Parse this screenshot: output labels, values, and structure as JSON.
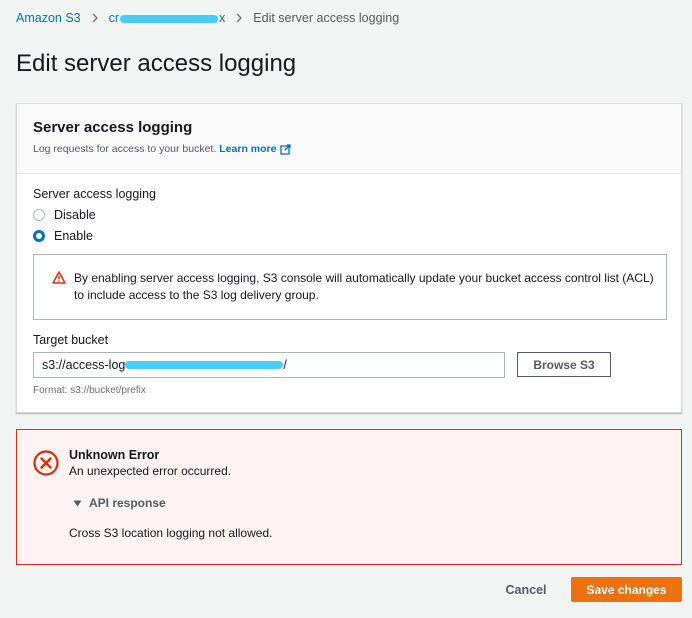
{
  "breadcrumb": {
    "root": "Amazon S3",
    "bucket_prefix": "cr",
    "bucket_suffix": "x",
    "current": "Edit server access logging"
  },
  "page_title": "Edit server access logging",
  "panel": {
    "title": "Server access logging",
    "description": "Log requests for access to your bucket.",
    "learn_more": "Learn more"
  },
  "logging_field": {
    "label": "Server access logging",
    "options": [
      {
        "label": "Disable",
        "selected": false
      },
      {
        "label": "Enable",
        "selected": true
      }
    ]
  },
  "warning": {
    "text": "By enabling server access logging, S3 console will automatically update your bucket access control list (ACL) to include access to the S3 log delivery group."
  },
  "target_bucket": {
    "label": "Target bucket",
    "value_prefix": "s3://access-log",
    "value_suffix": "/",
    "browse_label": "Browse S3",
    "hint": "Format: s3://bucket/prefix"
  },
  "error": {
    "title": "Unknown Error",
    "message": "An unexpected error occurred.",
    "api_toggle": "API response",
    "api_message": "Cross S3 location logging not allowed."
  },
  "actions": {
    "cancel": "Cancel",
    "save": "Save changes"
  },
  "colors": {
    "link": "#0073bb",
    "primary": "#ec7211",
    "error": "#d13212",
    "error_bg": "#fdf3f1"
  }
}
